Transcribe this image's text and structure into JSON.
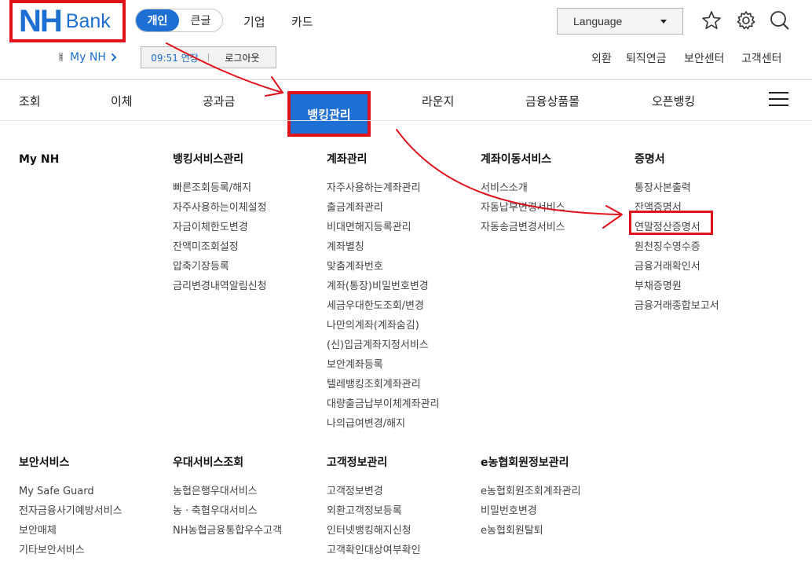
{
  "header": {
    "logo_nh": "NH",
    "logo_bank": "Bank",
    "segment": {
      "active": "개인",
      "inactive": "큰글"
    },
    "top_links": [
      "기업",
      "카드"
    ],
    "language": "Language",
    "mynh_bar": "ㅒ",
    "mynh_link": "My NH",
    "session": {
      "time": "09:51 연장",
      "logout": "로그아웃"
    },
    "util_links": [
      "외환",
      "퇴직연금",
      "보안센터",
      "고객센터"
    ]
  },
  "gnb": {
    "items": [
      "조회",
      "이체",
      "공과금",
      "뱅킹관리",
      "라운지",
      "금융상품몰",
      "오픈뱅킹"
    ],
    "active": "뱅킹관리"
  },
  "menu": {
    "row1": [
      {
        "title": "My NH",
        "items": []
      },
      {
        "title": "뱅킹서비스관리",
        "items": [
          "빠른조회등록/해지",
          "자주사용하는이체설정",
          "자금이체한도변경",
          "잔액미조회설정",
          "압축기장등록",
          "금리변경내역알림신청"
        ]
      },
      {
        "title": "계좌관리",
        "items": [
          "자주사용하는계좌관리",
          "출금계좌관리",
          "비대면해지등록관리",
          "계좌별칭",
          "맞춤계좌번호",
          "계좌(통장)비밀번호변경",
          "세금우대한도조회/변경",
          "나만의계좌(계좌숨김)",
          "(신)입금계좌지정서비스",
          "보안계좌등록",
          "텔레뱅킹조회계좌관리",
          "대량출금납부이체계좌관리",
          "나의급여변경/해지"
        ]
      },
      {
        "title": "계좌이동서비스",
        "items": [
          "서비스소개",
          "자동납부변경서비스",
          "자동송금변경서비스"
        ]
      },
      {
        "title": "증명서",
        "items": [
          "통장사본출력",
          "잔액증명서",
          "연말정산증명서",
          "원천징수영수증",
          "금융거래확인서",
          "부채증명원",
          "금융거래종합보고서"
        ]
      }
    ],
    "row2": [
      {
        "title": "보안서비스",
        "items": [
          "My Safe Guard",
          "전자금융사기예방서비스",
          "보안매체",
          "기타보안서비스"
        ]
      },
      {
        "title": "우대서비스조회",
        "items": [
          "농협은행우대서비스",
          "농ㆍ축협우대서비스",
          "NH농협금융통합우수고객"
        ]
      },
      {
        "title": "고객정보관리",
        "items": [
          "고객정보변경",
          "외환고객정보등록",
          "인터넷뱅킹해지신청",
          "고객확인대상여부확인"
        ]
      },
      {
        "title": "e농협회원정보관리",
        "items": [
          "e농협회원조회계좌관리",
          "비밀번호변경",
          "e농협회원탈퇴"
        ]
      }
    ]
  },
  "annotation_color": "#e0121c",
  "accent_color": "#1d6fd3",
  "icons": [
    "star-icon",
    "gear-icon",
    "search-icon",
    "hamburger-icon",
    "chevron-right-icon",
    "caret-down-icon"
  ]
}
